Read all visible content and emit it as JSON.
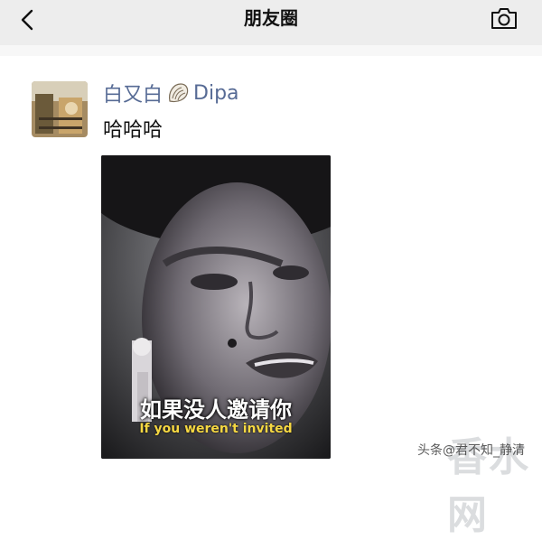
{
  "nav": {
    "title": "朋友圈",
    "back_icon": "chevron-left-icon",
    "camera_icon": "camera-icon"
  },
  "post": {
    "author_part1": "白又白",
    "author_emoji": "shell-icon",
    "author_part2": "Dipa",
    "text": "哈哈哈",
    "video": {
      "subtitle_cn": "如果没人邀请你",
      "subtitle_en": "If you weren't invited"
    }
  },
  "watermark": {
    "text": "头条@君不知_静清",
    "logo": "香水网"
  },
  "colors": {
    "navbar": "#ededed",
    "author_link": "#576b95",
    "subtitle_en": "#f5d742"
  }
}
